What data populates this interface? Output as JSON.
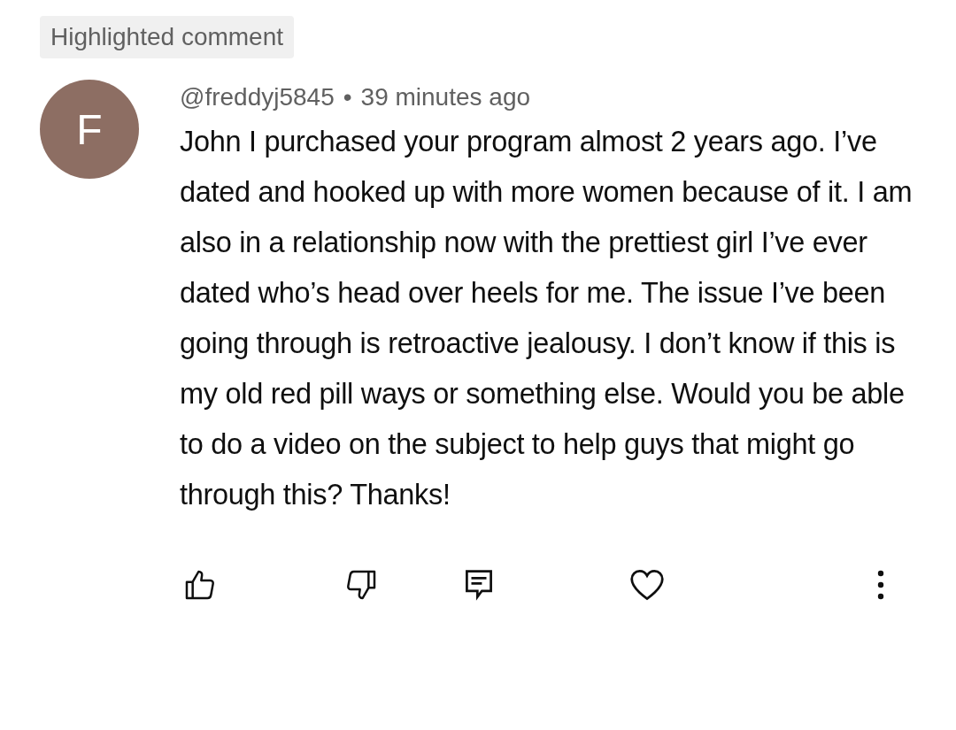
{
  "badge": "Highlighted comment",
  "comment": {
    "avatar_letter": "F",
    "author": "@freddyj5845",
    "separator": "•",
    "time": "39 minutes ago",
    "text": "John I purchased your program almost 2 years ago. I’ve dated and hooked up with more women because of it. I am also in a relationship now with the prettiest girl I’ve ever dated who’s head over heels for me. The issue I’ve been going through is retroactive jealousy. I don’t know if this is my old red pill ways or something else. Would you be able to do a video on the subject to help guys that might go through this? Thanks!",
    "liked": false,
    "disliked": false,
    "hearted": false
  }
}
